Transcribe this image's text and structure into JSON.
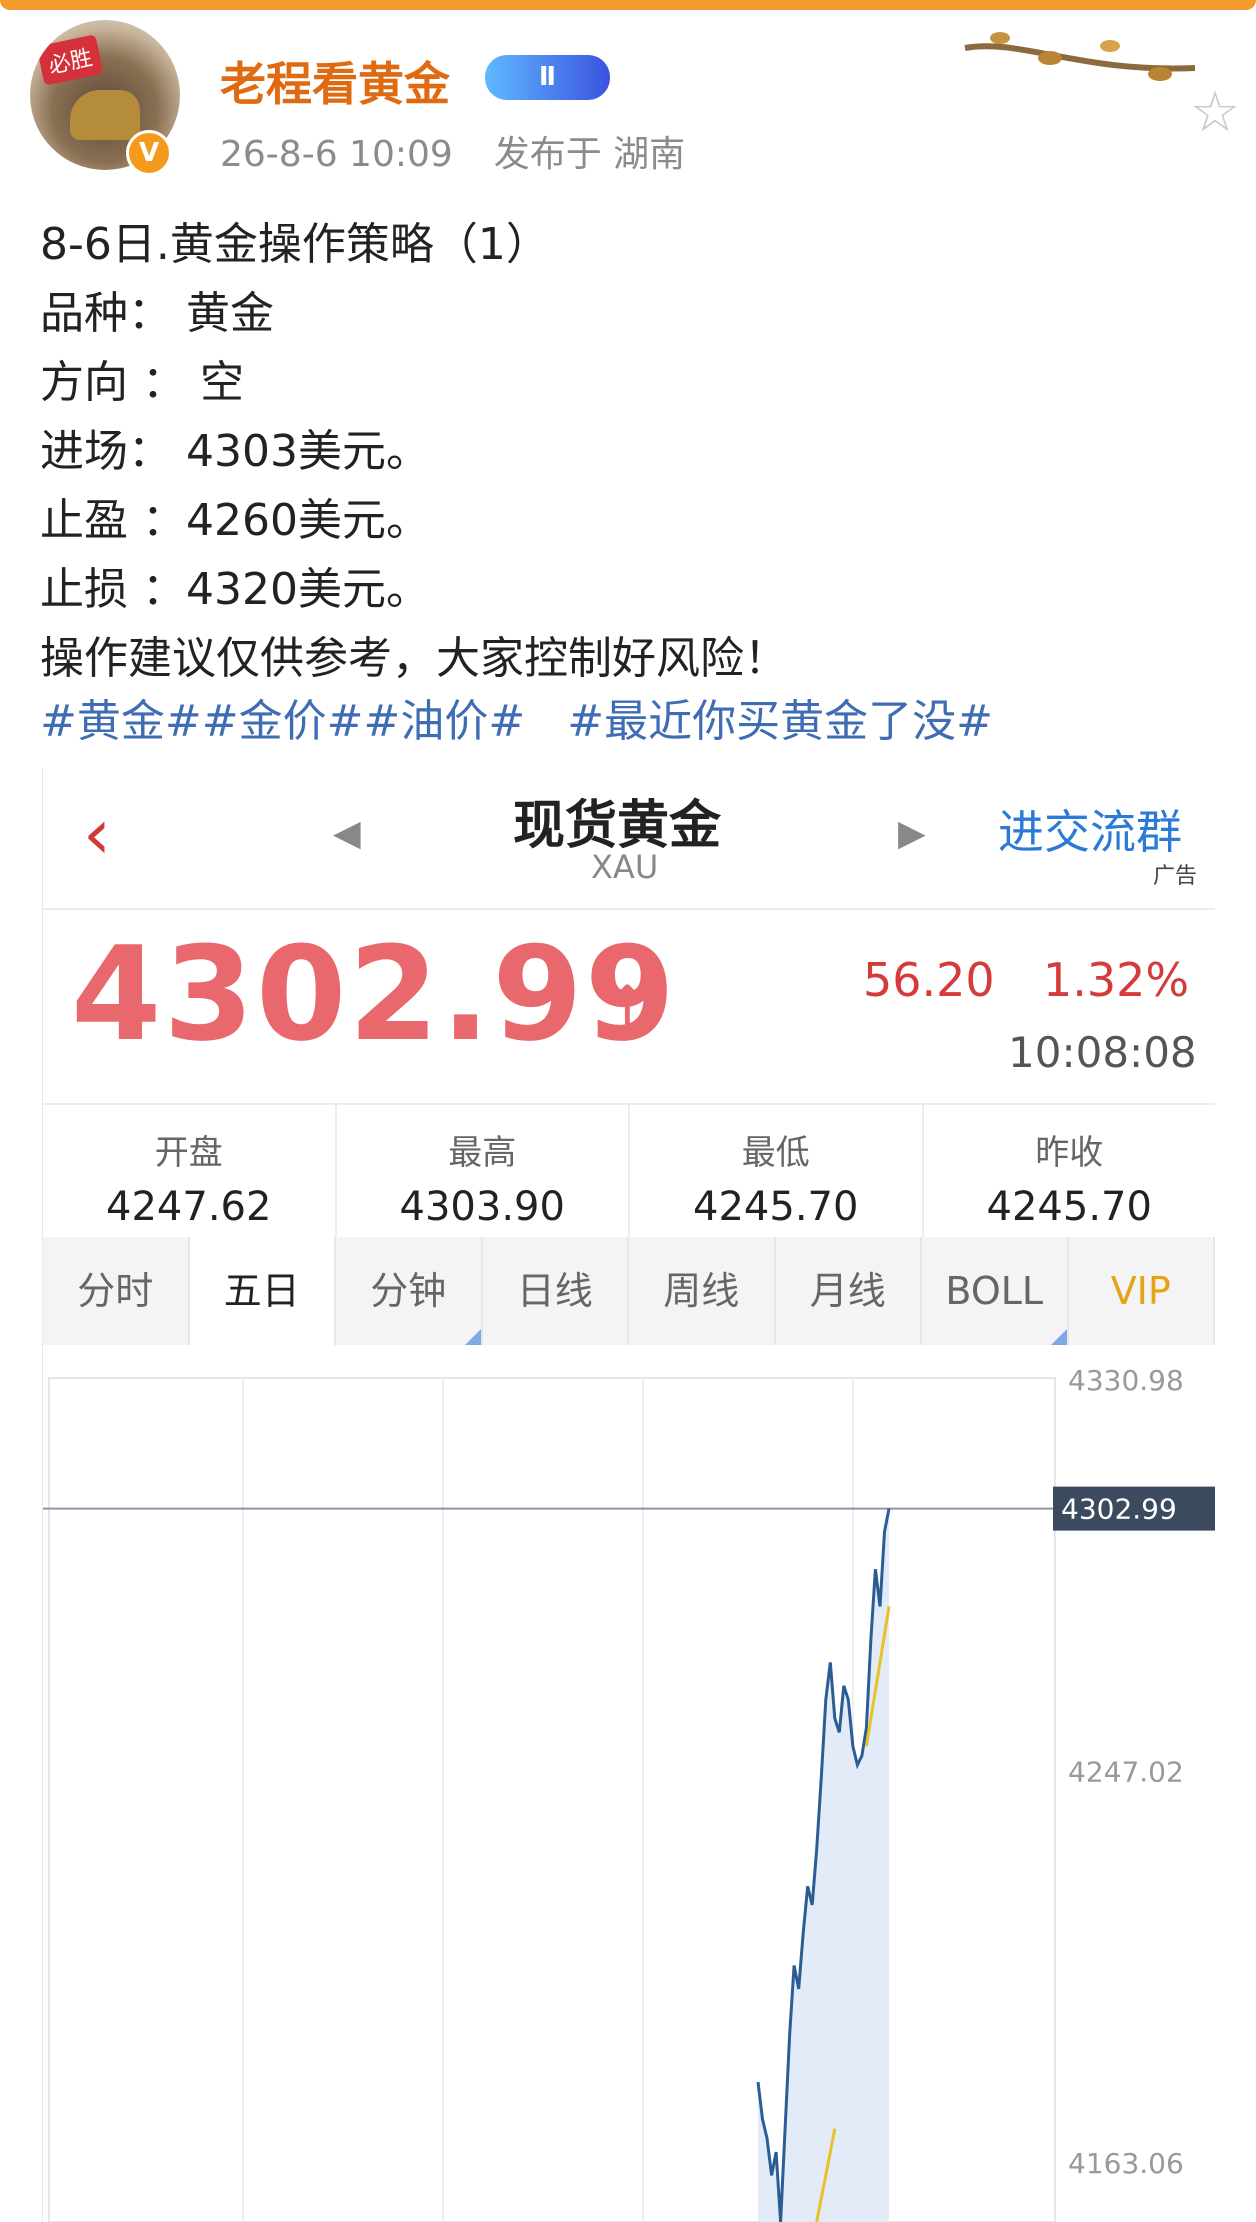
{
  "post": {
    "username": "老程看黄金",
    "level_badge": "Ⅱ",
    "avatar_tag": "必胜",
    "verified": "V",
    "date": "26-8-6 10:09",
    "location": "发布于 湖南",
    "lines": [
      "8-6日.黄金操作策略（1）",
      "品种：  黄金",
      "方向  ：  空",
      "进场：  4303美元。",
      "止盈  ：4260美元。",
      "止损  ：4320美元。",
      "操作建议仅供参考，大家控制好风险！"
    ],
    "hashtags": [
      "#黄金#",
      "#金价#",
      "#油价#",
      "#最近你买黄金了没#"
    ]
  },
  "quote": {
    "title": "现货黄金",
    "symbol": "XAU",
    "group_link": "进交流群",
    "ad_label": "广告",
    "price": "4302.99",
    "change": "56.20",
    "change_pct": "1.32%",
    "time": "10:08:08",
    "stats": [
      {
        "label": "开盘",
        "value": "4247.62"
      },
      {
        "label": "最高",
        "value": "4303.90"
      },
      {
        "label": "最低",
        "value": "4245.70"
      },
      {
        "label": "昨收",
        "value": "4245.70"
      }
    ],
    "tabs": [
      "分时",
      "五日",
      "分钟",
      "日线",
      "周线",
      "月线",
      "BOLL",
      "VIP"
    ],
    "active_tab": "五日"
  },
  "chart_data": {
    "type": "line",
    "title": "",
    "y_ticks": [
      "4330.98",
      "4302.99",
      "4247.02",
      "4163.06"
    ],
    "current_price_label": "4302.99",
    "ylim": [
      4150,
      4331
    ],
    "series": [
      {
        "values": [
          4180,
          4172,
          4168,
          4160,
          4165,
          4150,
          4170,
          4190,
          4205,
          4200,
          4212,
          4222,
          4218,
          4230,
          4245,
          4262,
          4270,
          4258,
          4255,
          4265,
          4262,
          4252,
          4248,
          4250,
          4256,
          4275,
          4290,
          4282,
          4298,
          4302.99
        ]
      },
      {
        "values": [
          null,
          null,
          null,
          null,
          null,
          null,
          null,
          null,
          null,
          null,
          null,
          null,
          null,
          null,
          null,
          null,
          null,
          null,
          null,
          null,
          null,
          null,
          null,
          null,
          4252,
          4258,
          4264,
          4270,
          4276,
          4282
        ]
      },
      {
        "values": [
          null,
          null,
          null,
          null,
          null,
          null,
          null,
          null,
          null,
          null,
          null,
          null,
          null,
          4150,
          4155,
          4160,
          4165,
          4170,
          null,
          null,
          null,
          null,
          null,
          null,
          null,
          null,
          null,
          null,
          null,
          null
        ]
      }
    ],
    "colors": {
      "line": "#2b5d95",
      "fill": "#e3ebf8",
      "ma": "#e9c227",
      "grid": "#e5e5e5",
      "price_tag_bg": "#3b4a5e"
    }
  }
}
